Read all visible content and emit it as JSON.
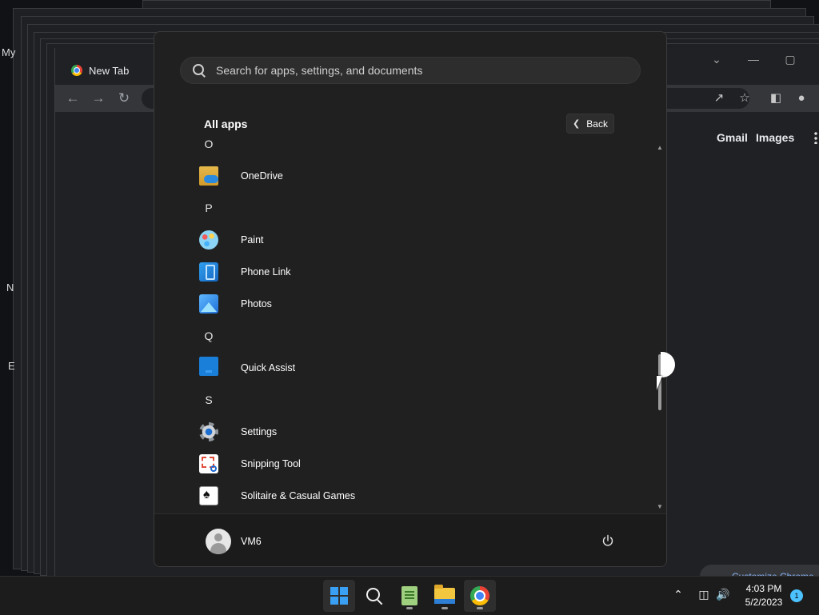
{
  "desktop": {
    "labels": [
      "My",
      "N",
      "E"
    ]
  },
  "chrome_window": {
    "tab_title": "New Tab",
    "links": [
      "Gmail",
      "Images"
    ],
    "customize_label": "Customize Chrome",
    "controls": {
      "minimize": "—",
      "maximize": "▢",
      "dropdown": "⌄"
    }
  },
  "start_menu": {
    "search": {
      "placeholder": "Search for apps, settings, and documents",
      "value": ""
    },
    "all_apps_title": "All apps",
    "back_label": "Back",
    "list": [
      {
        "kind": "letter",
        "text": "O"
      },
      {
        "kind": "app",
        "name": "OneDrive",
        "icon": "onedrive-icon"
      },
      {
        "kind": "letter",
        "text": "P"
      },
      {
        "kind": "app",
        "name": "Paint",
        "icon": "paint-icon"
      },
      {
        "kind": "app",
        "name": "Phone Link",
        "icon": "phone-link-icon"
      },
      {
        "kind": "app",
        "name": "Photos",
        "icon": "photos-icon"
      },
      {
        "kind": "letter",
        "text": "Q"
      },
      {
        "kind": "app",
        "name": "Quick Assist",
        "icon": "quick-assist-icon"
      },
      {
        "kind": "letter",
        "text": "S"
      },
      {
        "kind": "app",
        "name": "Settings",
        "icon": "settings-icon"
      },
      {
        "kind": "app",
        "name": "Snipping Tool",
        "icon": "snipping-tool-icon"
      },
      {
        "kind": "app",
        "name": "Solitaire & Casual Games",
        "icon": "solitaire-icon"
      }
    ],
    "user": {
      "name": "VM6"
    }
  },
  "taskbar": {
    "apps": [
      "start-button",
      "search-button",
      "notepad-app",
      "file-explorer-app",
      "chrome-app"
    ],
    "clock": {
      "time": "4:03 PM",
      "date": "5/2/2023"
    },
    "notification_count": "1",
    "accent_color": "#3aa0f3"
  }
}
